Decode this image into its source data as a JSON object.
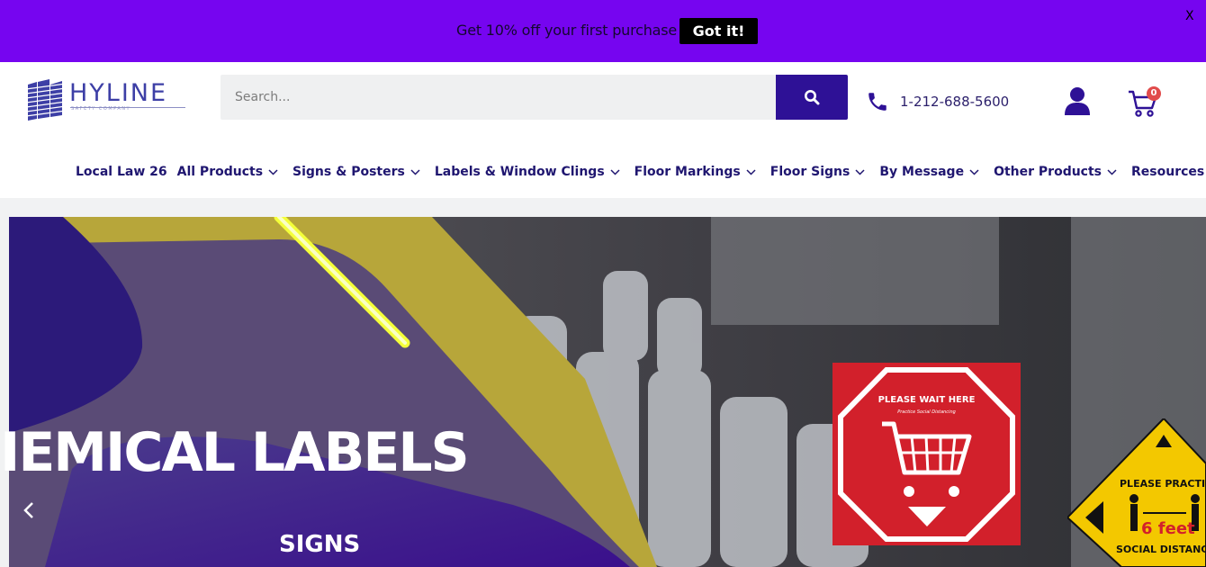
{
  "promo": {
    "text": "Get 10% off your first purchase",
    "button": "Got it!",
    "close": "X"
  },
  "header": {
    "logo_name": "HYLINE",
    "logo_tag": "SAFETY COMPANY",
    "search_placeholder": "Search...",
    "phone": "1-212-688-5600",
    "cart_count": "0"
  },
  "nav": {
    "items": [
      {
        "label": "Local Law 26",
        "dropdown": false
      },
      {
        "label": "All Products",
        "dropdown": true
      },
      {
        "label": "Signs & Posters",
        "dropdown": true
      },
      {
        "label": "Labels & Window Clings",
        "dropdown": true
      },
      {
        "label": "Floor Markings",
        "dropdown": true
      },
      {
        "label": "Floor Signs",
        "dropdown": true
      },
      {
        "label": "By Message",
        "dropdown": true
      },
      {
        "label": "Other Products",
        "dropdown": true
      },
      {
        "label": "Resources",
        "dropdown": true
      }
    ]
  },
  "hero": {
    "title": "IEMICAL LABELS",
    "subtitle": "SIGNS",
    "sign_red_title": "PLEASE WAIT HERE",
    "sign_red_sub": "Practice Social Distancing",
    "sign_yellow_top": "PLEASE PRACTICE",
    "sign_yellow_mid": "6 feet",
    "sign_yellow_bottom": "SOCIAL DISTANCING"
  },
  "colors": {
    "promo_bg": "#7605f0",
    "brand": "#2e1196",
    "nav_text": "#1f1670",
    "badge": "#e14b4b"
  }
}
